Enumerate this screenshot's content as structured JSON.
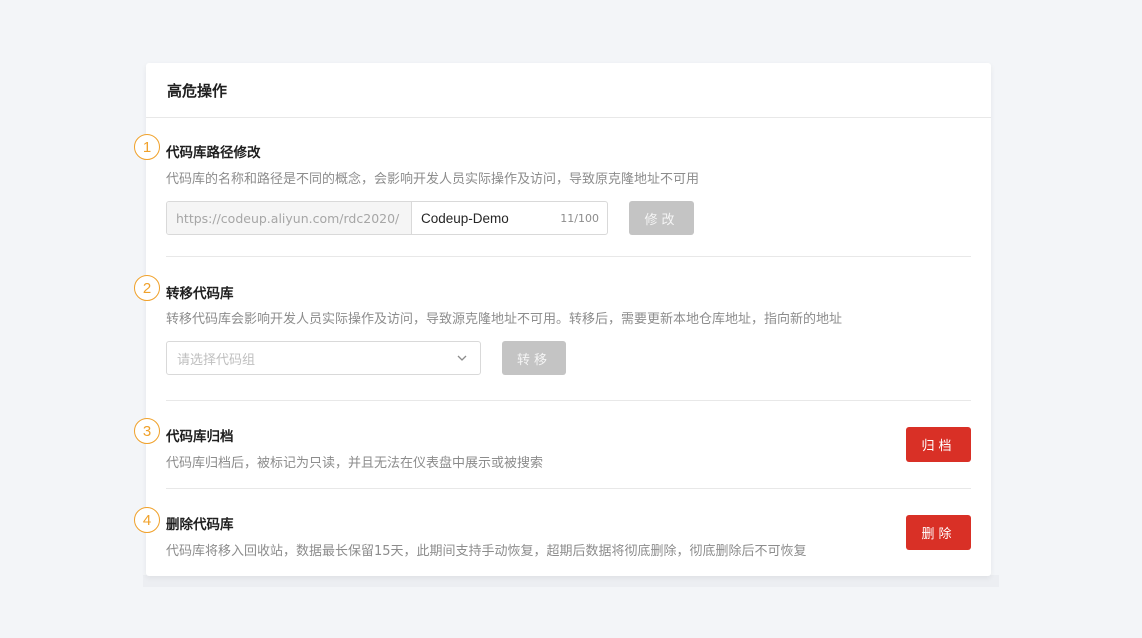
{
  "panel": {
    "title": "高危操作"
  },
  "sections": [
    {
      "marker": "1",
      "title": "代码库路径修改",
      "description": "代码库的名称和路径是不同的概念，会影响开发人员实际操作及访问，导致原克隆地址不可用",
      "url_prefix": "https://codeup.aliyun.com/rdc2020/",
      "path_value": "Codeup-Demo",
      "counter": "11/100",
      "button_label": "修改"
    },
    {
      "marker": "2",
      "title": "转移代码库",
      "description": "转移代码库会影响开发人员实际操作及访问，导致源克隆地址不可用。转移后，需要更新本地仓库地址，指向新的地址",
      "select_placeholder": "请选择代码组",
      "button_label": "转移"
    },
    {
      "marker": "3",
      "title": "代码库归档",
      "description": "代码库归档后，被标记为只读，并且无法在仪表盘中展示或被搜索",
      "button_label": "归档"
    },
    {
      "marker": "4",
      "title": "删除代码库",
      "description": "代码库将移入回收站，数据最长保留15天，此期间支持手动恢复，超期后数据将彻底删除，彻底删除后不可恢复",
      "button_label": "删除"
    }
  ],
  "colors": {
    "marker": "#f0a12a",
    "danger": "#d93026",
    "disabled": "#c4c4c4"
  },
  "icons": {
    "select_arrow": "chevron-down-icon"
  }
}
